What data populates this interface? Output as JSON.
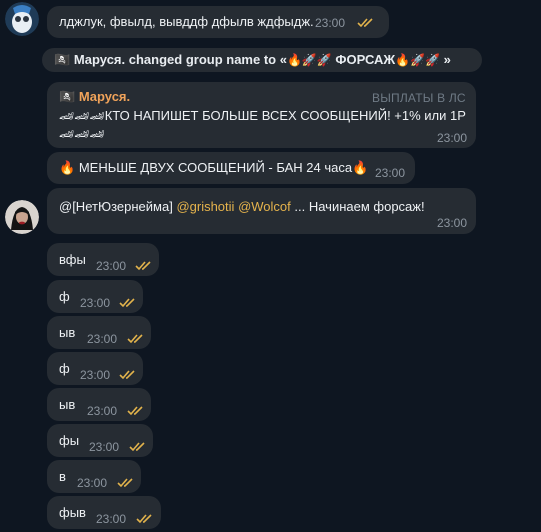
{
  "messages_top": {
    "m1": {
      "text": "лджлук, фвылд, вывддф дфылв ждфыдж.",
      "time": "23:00"
    }
  },
  "service": {
    "actor": "Маруся.",
    "action": "changed group name to «",
    "group_name": "ФОРСАЖ",
    "close": "»",
    "icon": "pirate-flag",
    "emojis_before": "🔥🚀🚀",
    "emojis_after": "🔥🚀🚀"
  },
  "reply_msg": {
    "sender": "Маруся.",
    "tag": "ВЫПЛАТЫ В ЛС",
    "line1_emoji": "🏎🏎🏎",
    "line1_text": "КТО НАПИШЕТ БОЛЬШЕ ВСЕХ СООБЩЕНИЙ! +1% или 1Р",
    "line2_emoji": "🏎🏎🏎",
    "time": "23:00"
  },
  "warn_msg": {
    "text": "МЕНЬШЕ ДВУХ СООБЩЕНИЙ - БАН 24 часа",
    "emoji_left": "🔥",
    "emoji_right": "🔥",
    "time": "23:00"
  },
  "mention_msg": {
    "prefix": "@[НетЮзернейма]",
    "mention1": "@grishotii",
    "mention2": "@Wolcof",
    "suffix": "... Начинаем форсаж!",
    "time": "23:00"
  },
  "short_msgs": [
    {
      "text": "вфы",
      "time": "23:00"
    },
    {
      "text": "ф",
      "time": "23:00"
    },
    {
      "text": "ыв",
      "time": "23:00"
    },
    {
      "text": "ф",
      "time": "23:00"
    },
    {
      "text": "ыв",
      "time": "23:00"
    },
    {
      "text": "фы",
      "time": "23:00"
    },
    {
      "text": "в",
      "time": "23:00"
    },
    {
      "text": "фыв",
      "time": "23:00"
    }
  ],
  "colors": {
    "background": "#0e1621",
    "bubble": "#262c33",
    "sender_name": "#f0a35a",
    "mention": "#e5b34c",
    "read_checks": "#e2b34c"
  }
}
